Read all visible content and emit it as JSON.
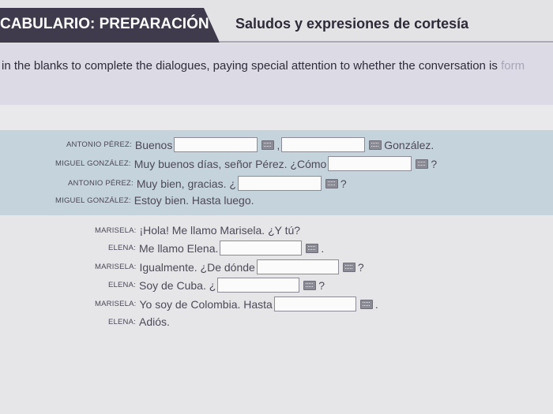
{
  "header": {
    "vocab_title": "CABULARIO: PREPARACIÓN",
    "subtitle": "Saludos y expresiones de cortesía"
  },
  "instructions": {
    "text": "in the blanks to complete the dialogues, paying special attention to whether the conversation is",
    "faded": "form"
  },
  "dialogue1": {
    "line1": {
      "speaker": "Antonio Pérez:",
      "text_a": "Buenos",
      "sep": ",",
      "text_b": "González."
    },
    "line2": {
      "speaker": "Miguel González:",
      "text_a": "Muy buenos días, señor Pérez. ¿Cómo",
      "end": "?"
    },
    "line3": {
      "speaker": "Antonio Pérez:",
      "text_a": "Muy bien, gracias. ¿",
      "end": "?"
    },
    "line4": {
      "speaker": "Miguel González:",
      "text_a": "Estoy bien. Hasta luego."
    }
  },
  "dialogue2": {
    "line1": {
      "speaker": "Marisela:",
      "text_a": "¡Hola! Me llamo Marisela. ¿Y tú?"
    },
    "line2": {
      "speaker": "Elena:",
      "text_a": "Me llamo Elena.",
      "end": "."
    },
    "line3": {
      "speaker": "Marisela:",
      "text_a": "Igualmente. ¿De dónde",
      "end": "?"
    },
    "line4": {
      "speaker": "Elena:",
      "text_a": "Soy de Cuba. ¿",
      "end": "?"
    },
    "line5": {
      "speaker": "Marisela:",
      "text_a": "Yo soy de Colombia. Hasta",
      "end": "."
    },
    "line6": {
      "speaker": "Elena:",
      "text_a": "Adiós."
    }
  }
}
